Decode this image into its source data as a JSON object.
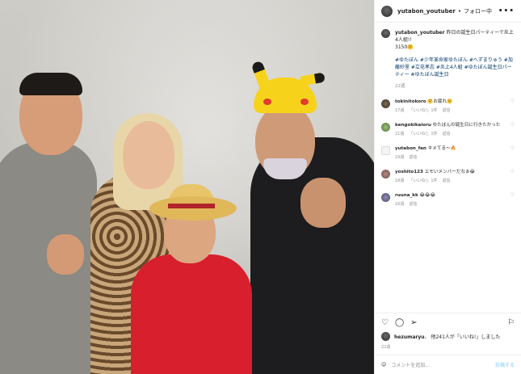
{
  "header": {
    "username": "yutabon_youtuber",
    "separator": "•",
    "follow_status": "フォロー中",
    "more": "•••"
  },
  "caption": {
    "username": "yutabon_youtuber",
    "text": "昨日の誕生日パーティーで炎上4人組!!",
    "line2": "3150🤗",
    "hashtags": "#ゆたぼん #少年革命家ゆたぼん #へずまりゅう #加藤紗里 #立花孝志 #炎上4人組 #ゆたぼん誕生日パーティー #ゆたぼん誕生日",
    "time": "22週"
  },
  "comments": [
    {
      "user": "tokinitokoro",
      "text": "🤗お疲れ🤗",
      "time": "17週",
      "likes": "「いいね!」1件",
      "reply": "返信"
    },
    {
      "user": "kengokikaioru",
      "text": "ゆたぼんの誕生日に行きたかった",
      "time": "21週",
      "likes": "「いいね!」1件",
      "reply": "返信"
    },
    {
      "user": "yutabon_fan",
      "text": "キメてる～🔥",
      "time": "19週",
      "likes": "",
      "reply": "返信"
    },
    {
      "user": "yoshito123",
      "text": "エモいメンバーだなぁ😂",
      "time": "18週",
      "likes": "「いいね!」1件",
      "reply": "返信"
    },
    {
      "user": "ruuna_kk",
      "text": "😂😂😂",
      "time": "16週",
      "likes": "",
      "reply": "返信"
    }
  ],
  "actions": {
    "like_icon": "heart-icon",
    "comment_icon": "comment-icon",
    "share_icon": "share-icon",
    "save_icon": "bookmark-icon"
  },
  "likes_text": "他241人が「いいね!」しました",
  "likes_user": "hezumaryu",
  "post_date": "22週",
  "comment_placeholder": "コメントを追加...",
  "post_button": "投稿する"
}
